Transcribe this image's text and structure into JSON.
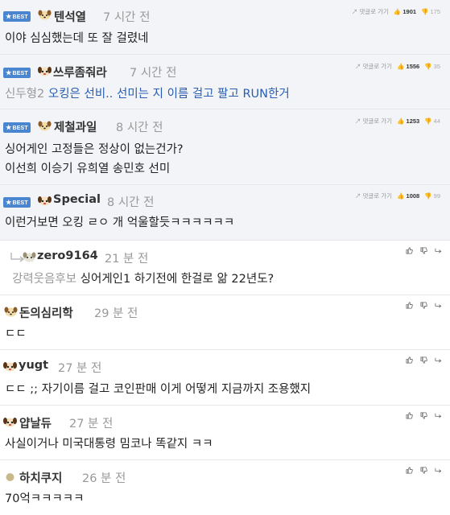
{
  "best_comments": [
    {
      "badge": "BEST",
      "nick": "텐석열",
      "time": "7 시간 전",
      "reply_label": "댓글로 가기",
      "up": "1901",
      "down": "175",
      "lines": [
        {
          "text": "이야 심심했는데 또 잘 걸렸네"
        }
      ]
    },
    {
      "badge": "BEST",
      "nick": "쓰루좀줘라",
      "time": "7 시간 전",
      "reply_label": "댓글로 가기",
      "up": "1556",
      "down": "35",
      "lead": "신두형2",
      "blue_text": "오킹은 선비.. 선미는 지 이름 걸고 팔고 RUN한거"
    },
    {
      "badge": "BEST",
      "nick": "제철과일",
      "time": "8 시간 전",
      "reply_label": "댓글로 가기",
      "up": "1253",
      "down": "44",
      "lines": [
        {
          "text": "싱어게인 고정들은 정상이 없는건가?"
        },
        {
          "text": "이선희 이승기 유희열 송민호 선미"
        }
      ]
    },
    {
      "badge": "BEST",
      "nick": "Special",
      "time": "8 시간 전",
      "reply_label": "댓글로 가기",
      "up": "1008",
      "down": "99",
      "lines": [
        {
          "text": "이런거보면 오킹 ㄹㅇ 개 억울할듯ㅋㅋㅋㅋㅋㅋ"
        }
      ]
    }
  ],
  "comments": [
    {
      "nick": "zero9164",
      "time": "21 분 전",
      "lead": "강력웃음후보",
      "text": "싱어게인1 하기전에 한걸로 앎 22년도?"
    },
    {
      "nick": "돈의심리학",
      "time": "29 분 전",
      "text": "ㄷㄷ"
    },
    {
      "nick": "yugt",
      "time": "27 분 전",
      "text": "ㄷㄷ ;; 자기이름 걸고 코인판매 이게 어떻게 지금까지 조용했지"
    },
    {
      "nick": "얍날듀",
      "time": "27 분 전",
      "text": "사실이거나 미국대통령 밈코나 똑같지 ㅋㅋ"
    },
    {
      "nick": "하치쿠지",
      "time": "26 분 전",
      "text": "70억ㅋㅋㅋㅋㅋ"
    }
  ],
  "colors": {
    "best_bg": "#f2f4f7",
    "badge": "#4a86d0",
    "link_blue": "#2a5db0",
    "divider": "#e4e6ea"
  },
  "icons": {
    "badge": "star-icon",
    "reply": "reply-arrow-icon",
    "up": "thumbs-up-icon",
    "down": "thumbs-down-icon",
    "avatar": "dog-avatar-icon"
  }
}
